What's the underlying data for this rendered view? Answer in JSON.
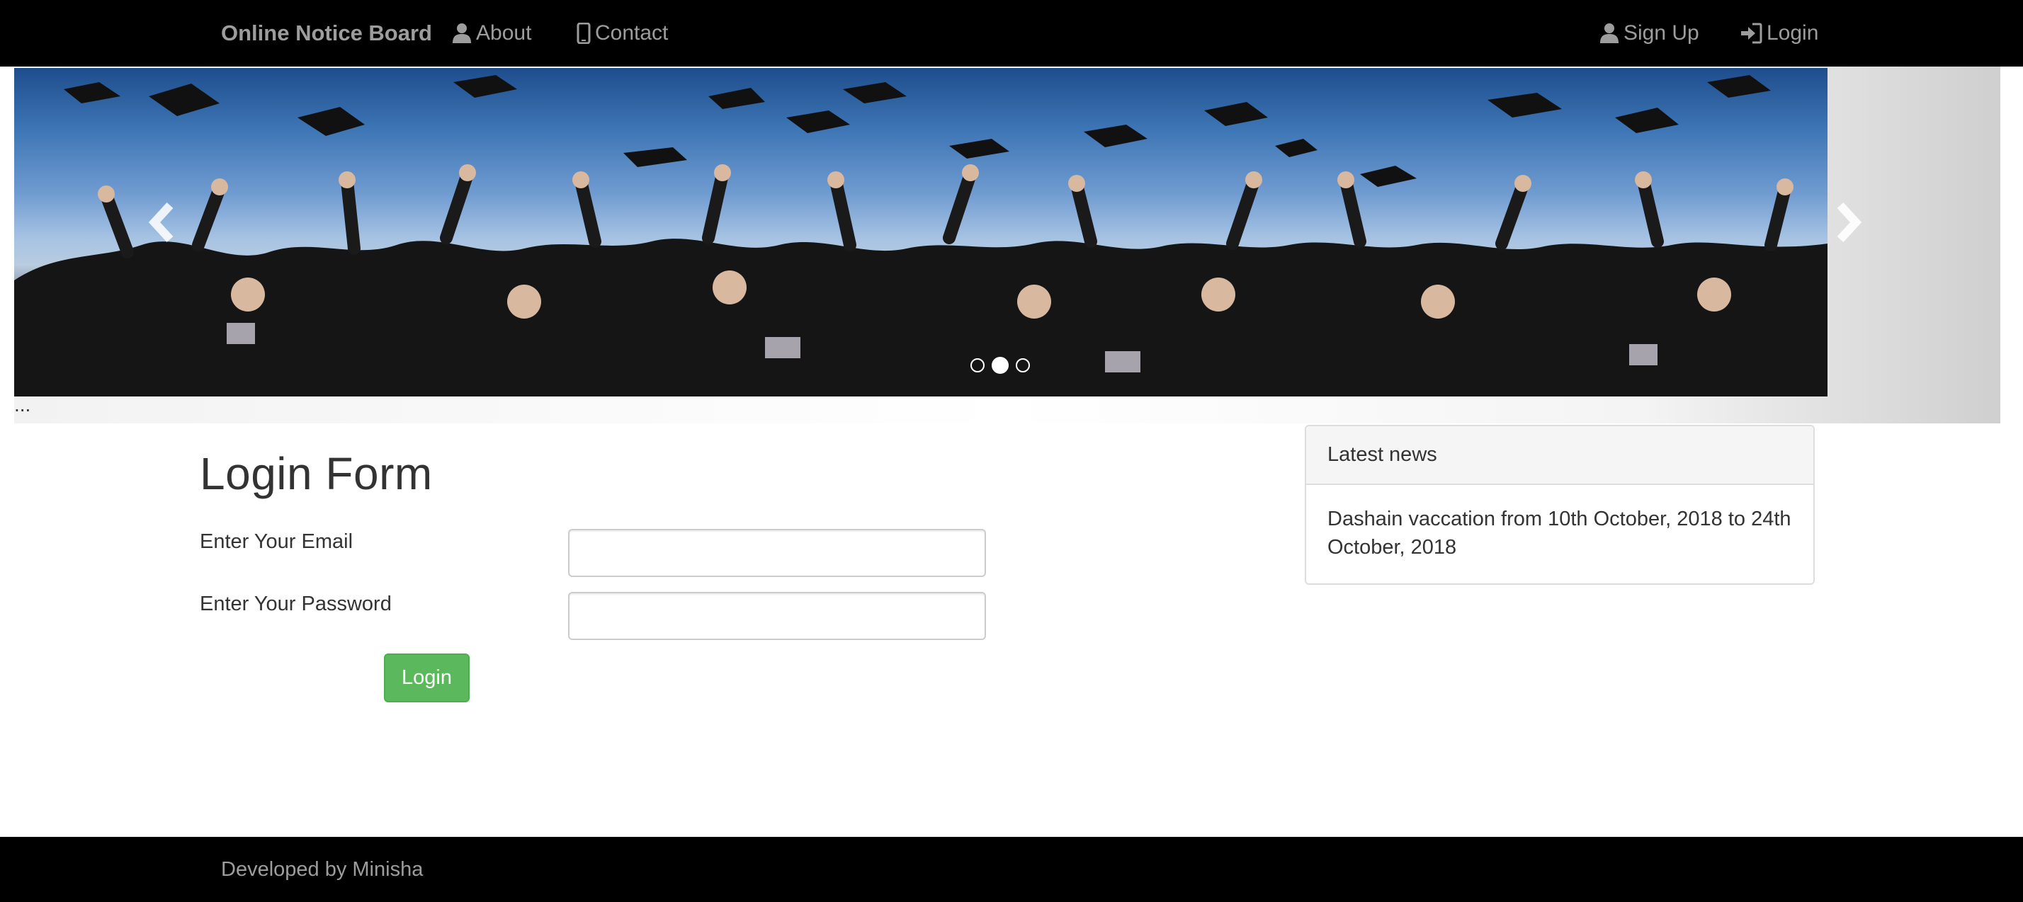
{
  "navbar": {
    "brand": "Online Notice Board",
    "about": "About",
    "contact": "Contact",
    "signup": "Sign Up",
    "login": "Login",
    "icons": {
      "about": "user-icon",
      "contact": "phone-icon",
      "signup": "user-icon",
      "login": "login-icon"
    }
  },
  "carousel": {
    "slide_description_icon": "graduation-photo",
    "indicator_count": 3,
    "active_indicator": 2,
    "caption": "..."
  },
  "login_form": {
    "title": "Login Form",
    "email_label": "Enter Your Email",
    "email_value": "",
    "password_label": "Enter Your Password",
    "password_value": "",
    "submit_label": "Login",
    "submit_color": "#5cb85c"
  },
  "news": {
    "heading": "Latest news",
    "item": "Dashain vaccation from 10th October, 2018 to 24th October, 2018"
  },
  "footer": {
    "text": "Developed by Minisha"
  },
  "colors": {
    "navbar_bg": "#000000",
    "nav_text": "#9d9d9d",
    "panel_heading_bg": "#f5f5f5",
    "panel_border": "#dddddd"
  }
}
